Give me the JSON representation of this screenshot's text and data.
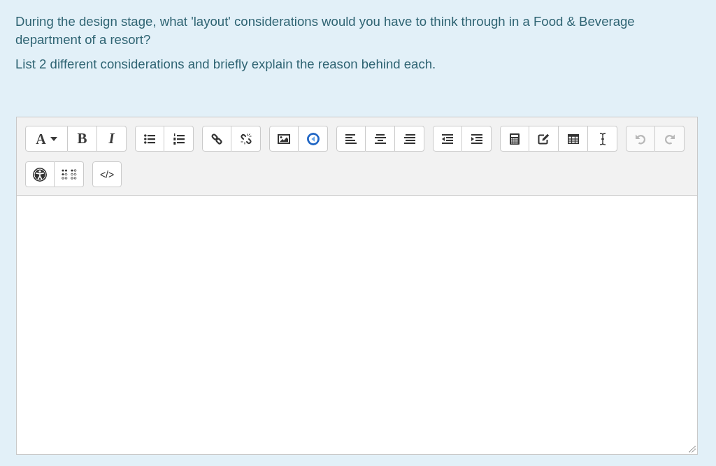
{
  "question": {
    "paragraphs": [
      "During the design stage, what 'layout' considerations would you have to think through in a Food & Beverage department of a resort?",
      "List 2 different considerations and briefly explain the reason behind each."
    ]
  },
  "editor": {
    "toolbar": {
      "rows": [
        {
          "groups": [
            {
              "buttons": [
                {
                  "kind": "font",
                  "label": "A",
                  "disabled": false
                },
                {
                  "kind": "bold",
                  "label": "B",
                  "disabled": false
                },
                {
                  "kind": "italic",
                  "label": "I",
                  "disabled": false
                }
              ]
            },
            {
              "buttons": [
                {
                  "kind": "bullets",
                  "disabled": false
                },
                {
                  "kind": "numbers",
                  "disabled": false
                }
              ]
            },
            {
              "buttons": [
                {
                  "kind": "link",
                  "disabled": false
                },
                {
                  "kind": "unlink",
                  "disabled": false
                }
              ]
            },
            {
              "buttons": [
                {
                  "kind": "image",
                  "disabled": false
                },
                {
                  "kind": "media",
                  "disabled": false
                }
              ]
            },
            {
              "buttons": [
                {
                  "kind": "left",
                  "disabled": false
                },
                {
                  "kind": "center",
                  "disabled": false
                },
                {
                  "kind": "right",
                  "disabled": false
                }
              ]
            },
            {
              "buttons": [
                {
                  "kind": "outdent",
                  "disabled": false
                },
                {
                  "kind": "indent",
                  "disabled": false
                }
              ]
            },
            {
              "buttons": [
                {
                  "kind": "equation",
                  "disabled": false
                },
                {
                  "kind": "charmap",
                  "disabled": false
                },
                {
                  "kind": "table",
                  "disabled": false
                },
                {
                  "kind": "clear",
                  "disabled": false
                }
              ]
            },
            {
              "buttons": [
                {
                  "kind": "undo",
                  "disabled": true
                },
                {
                  "kind": "redo",
                  "disabled": true
                }
              ]
            }
          ]
        },
        {
          "groups": [
            {
              "buttons": [
                {
                  "kind": "accessibility",
                  "disabled": false
                },
                {
                  "kind": "braille",
                  "disabled": false
                }
              ]
            },
            {
              "buttons": [
                {
                  "kind": "code",
                  "label": "</>",
                  "disabled": false
                }
              ]
            }
          ]
        }
      ]
    }
  }
}
